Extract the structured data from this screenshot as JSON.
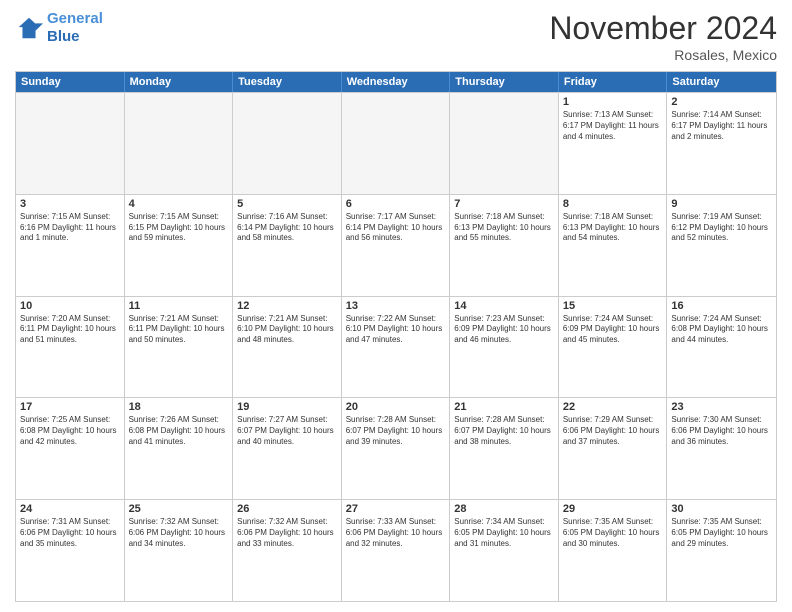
{
  "header": {
    "logo_line1": "General",
    "logo_line2": "Blue",
    "month_title": "November 2024",
    "location": "Rosales, Mexico"
  },
  "days_of_week": [
    "Sunday",
    "Monday",
    "Tuesday",
    "Wednesday",
    "Thursday",
    "Friday",
    "Saturday"
  ],
  "weeks": [
    [
      {
        "day": "",
        "info": "",
        "empty": true
      },
      {
        "day": "",
        "info": "",
        "empty": true
      },
      {
        "day": "",
        "info": "",
        "empty": true
      },
      {
        "day": "",
        "info": "",
        "empty": true
      },
      {
        "day": "",
        "info": "",
        "empty": true
      },
      {
        "day": "1",
        "info": "Sunrise: 7:13 AM\nSunset: 6:17 PM\nDaylight: 11 hours and 4 minutes.",
        "empty": false
      },
      {
        "day": "2",
        "info": "Sunrise: 7:14 AM\nSunset: 6:17 PM\nDaylight: 11 hours and 2 minutes.",
        "empty": false
      }
    ],
    [
      {
        "day": "3",
        "info": "Sunrise: 7:15 AM\nSunset: 6:16 PM\nDaylight: 11 hours and 1 minute.",
        "empty": false
      },
      {
        "day": "4",
        "info": "Sunrise: 7:15 AM\nSunset: 6:15 PM\nDaylight: 10 hours and 59 minutes.",
        "empty": false
      },
      {
        "day": "5",
        "info": "Sunrise: 7:16 AM\nSunset: 6:14 PM\nDaylight: 10 hours and 58 minutes.",
        "empty": false
      },
      {
        "day": "6",
        "info": "Sunrise: 7:17 AM\nSunset: 6:14 PM\nDaylight: 10 hours and 56 minutes.",
        "empty": false
      },
      {
        "day": "7",
        "info": "Sunrise: 7:18 AM\nSunset: 6:13 PM\nDaylight: 10 hours and 55 minutes.",
        "empty": false
      },
      {
        "day": "8",
        "info": "Sunrise: 7:18 AM\nSunset: 6:13 PM\nDaylight: 10 hours and 54 minutes.",
        "empty": false
      },
      {
        "day": "9",
        "info": "Sunrise: 7:19 AM\nSunset: 6:12 PM\nDaylight: 10 hours and 52 minutes.",
        "empty": false
      }
    ],
    [
      {
        "day": "10",
        "info": "Sunrise: 7:20 AM\nSunset: 6:11 PM\nDaylight: 10 hours and 51 minutes.",
        "empty": false
      },
      {
        "day": "11",
        "info": "Sunrise: 7:21 AM\nSunset: 6:11 PM\nDaylight: 10 hours and 50 minutes.",
        "empty": false
      },
      {
        "day": "12",
        "info": "Sunrise: 7:21 AM\nSunset: 6:10 PM\nDaylight: 10 hours and 48 minutes.",
        "empty": false
      },
      {
        "day": "13",
        "info": "Sunrise: 7:22 AM\nSunset: 6:10 PM\nDaylight: 10 hours and 47 minutes.",
        "empty": false
      },
      {
        "day": "14",
        "info": "Sunrise: 7:23 AM\nSunset: 6:09 PM\nDaylight: 10 hours and 46 minutes.",
        "empty": false
      },
      {
        "day": "15",
        "info": "Sunrise: 7:24 AM\nSunset: 6:09 PM\nDaylight: 10 hours and 45 minutes.",
        "empty": false
      },
      {
        "day": "16",
        "info": "Sunrise: 7:24 AM\nSunset: 6:08 PM\nDaylight: 10 hours and 44 minutes.",
        "empty": false
      }
    ],
    [
      {
        "day": "17",
        "info": "Sunrise: 7:25 AM\nSunset: 6:08 PM\nDaylight: 10 hours and 42 minutes.",
        "empty": false
      },
      {
        "day": "18",
        "info": "Sunrise: 7:26 AM\nSunset: 6:08 PM\nDaylight: 10 hours and 41 minutes.",
        "empty": false
      },
      {
        "day": "19",
        "info": "Sunrise: 7:27 AM\nSunset: 6:07 PM\nDaylight: 10 hours and 40 minutes.",
        "empty": false
      },
      {
        "day": "20",
        "info": "Sunrise: 7:28 AM\nSunset: 6:07 PM\nDaylight: 10 hours and 39 minutes.",
        "empty": false
      },
      {
        "day": "21",
        "info": "Sunrise: 7:28 AM\nSunset: 6:07 PM\nDaylight: 10 hours and 38 minutes.",
        "empty": false
      },
      {
        "day": "22",
        "info": "Sunrise: 7:29 AM\nSunset: 6:06 PM\nDaylight: 10 hours and 37 minutes.",
        "empty": false
      },
      {
        "day": "23",
        "info": "Sunrise: 7:30 AM\nSunset: 6:06 PM\nDaylight: 10 hours and 36 minutes.",
        "empty": false
      }
    ],
    [
      {
        "day": "24",
        "info": "Sunrise: 7:31 AM\nSunset: 6:06 PM\nDaylight: 10 hours and 35 minutes.",
        "empty": false
      },
      {
        "day": "25",
        "info": "Sunrise: 7:32 AM\nSunset: 6:06 PM\nDaylight: 10 hours and 34 minutes.",
        "empty": false
      },
      {
        "day": "26",
        "info": "Sunrise: 7:32 AM\nSunset: 6:06 PM\nDaylight: 10 hours and 33 minutes.",
        "empty": false
      },
      {
        "day": "27",
        "info": "Sunrise: 7:33 AM\nSunset: 6:06 PM\nDaylight: 10 hours and 32 minutes.",
        "empty": false
      },
      {
        "day": "28",
        "info": "Sunrise: 7:34 AM\nSunset: 6:05 PM\nDaylight: 10 hours and 31 minutes.",
        "empty": false
      },
      {
        "day": "29",
        "info": "Sunrise: 7:35 AM\nSunset: 6:05 PM\nDaylight: 10 hours and 30 minutes.",
        "empty": false
      },
      {
        "day": "30",
        "info": "Sunrise: 7:35 AM\nSunset: 6:05 PM\nDaylight: 10 hours and 29 minutes.",
        "empty": false
      }
    ]
  ]
}
